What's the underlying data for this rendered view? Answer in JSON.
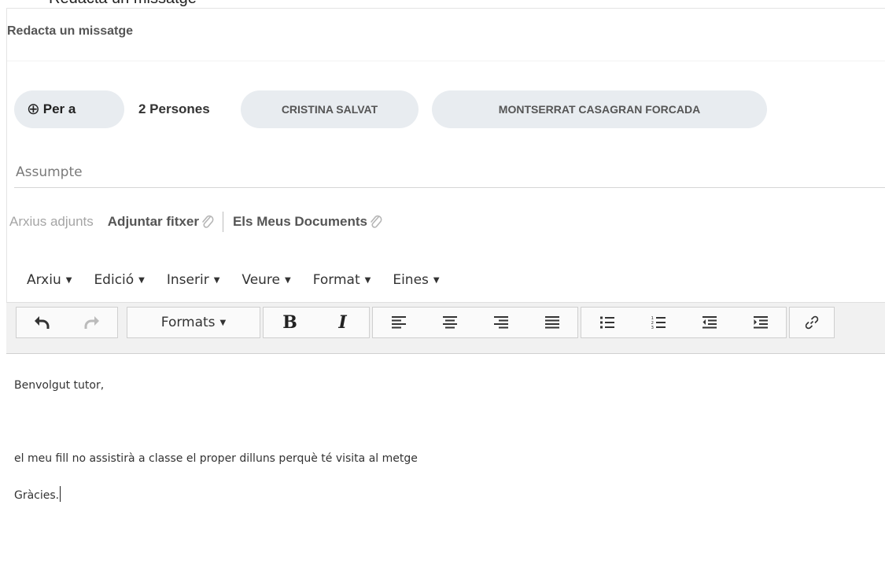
{
  "top_strip_text": "Redacta un missatge",
  "panel": {
    "title": "Redacta un missatge"
  },
  "recipients": {
    "to_label": "Per a",
    "count_label": "2 Persones",
    "chips": [
      "CRISTINA SALVAT",
      "MONTSERRAT CASAGRAN FORCADA"
    ]
  },
  "subject": {
    "placeholder": "Assumpte",
    "value": ""
  },
  "attachments": {
    "label": "Arxius adjunts",
    "attach_file": "Adjuntar fitxer",
    "my_documents": "Els Meus Documents"
  },
  "menubar": [
    "Arxiu",
    "Edició",
    "Inserir",
    "Veure",
    "Format",
    "Eines"
  ],
  "toolbar": {
    "formats_label": "Formats",
    "bold_label": "B",
    "italic_label": "I"
  },
  "icons": {
    "undo": "undo-icon",
    "redo": "redo-icon",
    "paperclip": "paperclip-icon",
    "align_left": "align-left-icon",
    "align_center": "align-center-icon",
    "align_right": "align-right-icon",
    "align_justify": "align-justify-icon",
    "bullet_list": "bullet-list-icon",
    "numbered_list": "numbered-list-icon",
    "outdent": "outdent-icon",
    "indent": "indent-icon",
    "link": "link-icon",
    "plus": "plus-circle-icon",
    "caret": "caret-down-icon"
  },
  "editor": {
    "lines": [
      "Benvolgut tutor,",
      "el meu fill no assistirà a classe el proper dilluns perquè té visita al metge",
      "Gràcies."
    ]
  },
  "colors": {
    "chip_bg": "#e8ecf0",
    "toolbar_bg": "#f1f1f1",
    "muted_text": "#a5a5a5"
  }
}
